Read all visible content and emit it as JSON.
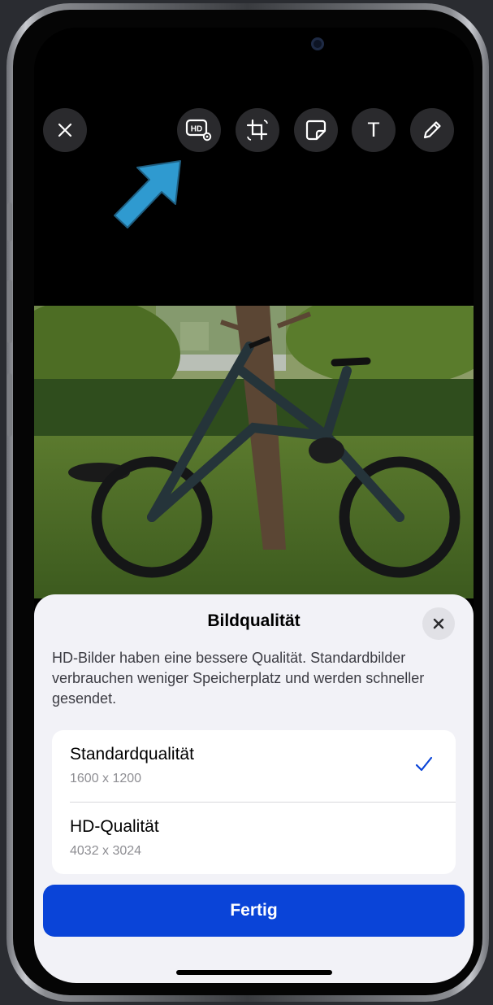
{
  "toolbar": {
    "close_icon": "close-icon",
    "tools": [
      "hd-quality-icon",
      "crop-rotate-icon",
      "sticker-icon",
      "text-icon",
      "pencil-icon"
    ],
    "hd_label": "HD",
    "text_tool_label": "T"
  },
  "annotation": {
    "arrow_color": "#2f9ad0"
  },
  "sheet": {
    "title": "Bildqualität",
    "description": "HD-Bilder haben eine bessere Qualität. Standardbilder verbrauchen weniger Speicherplatz und werden schneller gesendet.",
    "options": [
      {
        "label": "Standardqualität",
        "resolution": "1600 x 1200",
        "selected": true
      },
      {
        "label": "HD-Qualität",
        "resolution": "4032 x 3024",
        "selected": false
      }
    ],
    "done_label": "Fertig",
    "accent": "#0a44d8"
  }
}
